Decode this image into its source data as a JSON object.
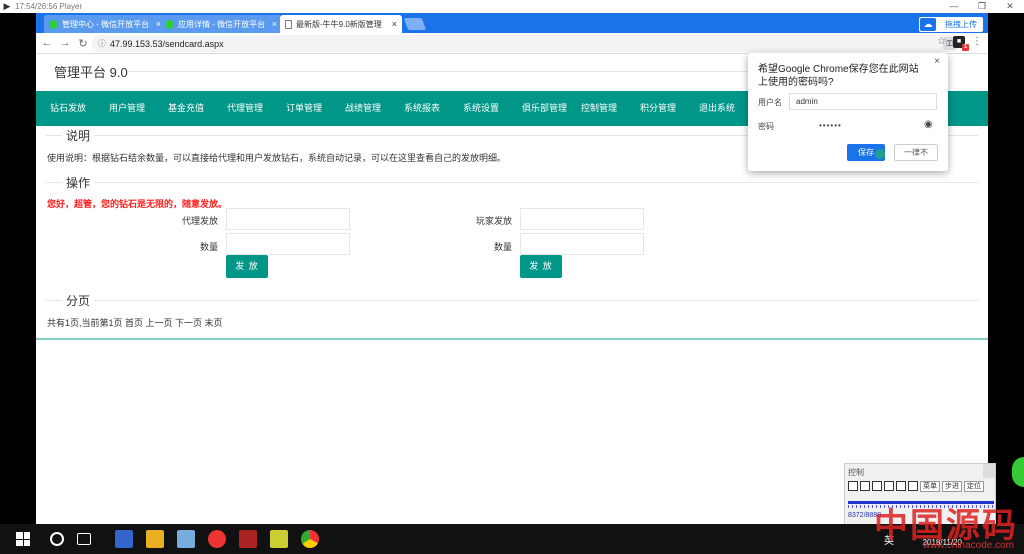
{
  "player": {
    "title": "17:54/26:56 Player",
    "min": "—",
    "max": "❐",
    "close": "✕"
  },
  "tabs": [
    {
      "label": "管理中心 - 微信开放平台",
      "close": "×"
    },
    {
      "label": "应用详情 - 微信开放平台",
      "close": "×"
    },
    {
      "label": "最新版-牛牛9.0新版管理",
      "close": "×"
    }
  ],
  "upload_button": "拖拽上传",
  "address": {
    "url": "47.99.153.53/sendcard.aspx"
  },
  "site_title": "管理平台 9.0",
  "menu": [
    "钻石发放",
    "用户管理",
    "基金充值",
    "代理管理",
    "订单管理",
    "战绩管理",
    "系统报表",
    "系统设置",
    "俱乐部管理",
    "控制管理",
    "积分管理",
    "退出系统"
  ],
  "sections": {
    "desc_legend": "说明",
    "desc_text": "使用说明：根据钻石结余数量，可以直接给代理和用户发放钻石，系统自动记录，可以在这里查看自己的发放明细。",
    "op_legend": "操作",
    "warn_text": "您好，超管，您的钻石是无限的，随意发放。",
    "pager_legend": "分页",
    "pager_text": "共有1页,当前第1页 首页 上一页 下一页 末页"
  },
  "form": {
    "agent_label": "代理发放",
    "player_label": "玩家发放",
    "qty_label": "数量",
    "submit": "发 放"
  },
  "password_popup": {
    "title": "希望Google Chrome保存您在此网站上使用的密码吗?",
    "close": "×",
    "username_label": "用户名",
    "username_value": "admin",
    "password_label": "密码",
    "password_value": "••••••",
    "save": "保存",
    "never": "一律不"
  },
  "control_panel": {
    "title": "控制",
    "menu_btn": "菜单",
    "step_btn": "步进",
    "locate_btn": "定位",
    "status": "8372/8888"
  },
  "taskbar": {
    "lang": "英",
    "date": "2018/11/20"
  },
  "watermark": {
    "main": "中国源码",
    "sub": "www.chinacode.com"
  }
}
